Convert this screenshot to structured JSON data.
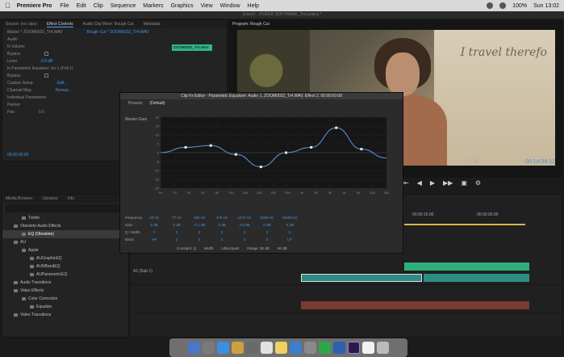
{
  "menubar": {
    "app_name": "Premiere Pro",
    "items": [
      "File",
      "Edit",
      "Clip",
      "Sequence",
      "Markers",
      "Graphics",
      "View",
      "Window",
      "Help"
    ],
    "battery": "100%",
    "clock": "Sun 13:02"
  },
  "window_title": "/Users/.../YUEER SOFTWARE_Test.prproj *",
  "effect_controls": {
    "tabs": [
      "Source: (no clips)",
      "Effect Controls",
      "Audio Clip Mixer: Rough Cut",
      "Metadata"
    ],
    "active_tab": "Effect Controls",
    "clip_path": "Master * ZOOM0032_Tr4.WAV",
    "sequence_path": "Rough Cut * ZOOM0032_Tr4.WAV",
    "clip_chip": "ZOOM0032_Tr4.WAV",
    "rows": [
      {
        "label": "Audio",
        "value": ""
      },
      {
        "label": "fx  Volume",
        "value": ""
      },
      {
        "label": "Bypass",
        "value": ""
      },
      {
        "label": "Level",
        "value": "0.0 dB"
      },
      {
        "label": "fx  Parametric Equalizer: Ex 1 (Fx8.1)",
        "value": ""
      },
      {
        "label": "Bypass",
        "value": ""
      },
      {
        "label": "Custom Setup",
        "value": "Edit..."
      },
      {
        "label": "Channel Map",
        "value": "Remap..."
      },
      {
        "label": "Individual Parameters",
        "value": ""
      },
      {
        "label": "Panner",
        "value": ""
      },
      {
        "label": "Pan",
        "value": "0.0"
      }
    ],
    "timecode": "00:00:00:00"
  },
  "program_monitor": {
    "title": "Program: Rough Cut",
    "script_text": "I travel therefo",
    "fit": "Full",
    "timecode": "00:14:34:12"
  },
  "eq_dialog": {
    "title": "Clip Fx Editor - Parametric Equalizer: Audio 1, ZOOM0032_Tr4.WAV, Effect 2, 00:00:00:00",
    "presets_label": "Presets:",
    "preset_value": "(Default)",
    "master_gain": "Master Gain",
    "y_ticks": [
      "20",
      "15",
      "10",
      "5",
      "0",
      "-5",
      "-10",
      "-15",
      "-20"
    ],
    "x_ticks": [
      "Hz",
      "20",
      "40",
      "60",
      "80",
      "100",
      "200",
      "300",
      "400",
      "500",
      "1k",
      "2k",
      "3k",
      "4k",
      "5k",
      "10k",
      "20k"
    ],
    "table": {
      "frequency_label": "Frequency",
      "gain_label": "Gain",
      "q_label": "Q / Width",
      "band_label": "Band",
      "frequencies": [
        "40 Hz",
        "77 Hz",
        "160 Hz",
        "475 Hz",
        "1474 Hz",
        "5369 Hz",
        "10000 Hz"
      ],
      "gains": [
        "5 dB",
        "0 dB",
        "-7.1 dB",
        "0 dB",
        "4.9 dB",
        "0 dB",
        "-4 dB"
      ],
      "q_values": [
        "2",
        "2",
        "2",
        "2",
        "2",
        "2",
        "2"
      ],
      "bands": [
        "HP",
        "1",
        "2",
        "3",
        "4",
        "5",
        "LP"
      ]
    },
    "bottom_options": [
      "Constant: Q",
      "Width",
      "Ultra-Quiet",
      "Range: 30 dB",
      "96 dB"
    ]
  },
  "chart_data": {
    "type": "line",
    "title": "",
    "x": [
      "20",
      "40",
      "100",
      "200",
      "400",
      "1k",
      "2k",
      "4k",
      "10k",
      "20k"
    ],
    "series": [
      {
        "values": [
          0,
          3,
          4,
          -1,
          -8,
          0,
          3,
          14,
          2,
          -3
        ]
      }
    ],
    "ylim": [
      -20,
      20
    ],
    "grid": true
  },
  "project_panel": {
    "tabs": [
      "Media Browser",
      "Libraries",
      "Info"
    ],
    "items": [
      {
        "label": "Treble",
        "selected": false
      },
      {
        "label": "Obsolete Audio Effects",
        "selected": false
      },
      {
        "label": "EQ (Obsolete)",
        "selected": true
      },
      {
        "label": "AU",
        "selected": false
      },
      {
        "label": "Apple",
        "selected": false
      },
      {
        "label": "AUGraphicEQ",
        "selected": false
      },
      {
        "label": "AUNBandEQ",
        "selected": false
      },
      {
        "label": "AUParametricEQ",
        "selected": false
      },
      {
        "label": "Audio Transitions",
        "selected": false
      },
      {
        "label": "Video Effects",
        "selected": false
      },
      {
        "label": "Color Correction",
        "selected": false
      },
      {
        "label": "Equalize",
        "selected": false
      },
      {
        "label": "Video Transitions",
        "selected": false
      }
    ]
  },
  "timeline": {
    "ruler": [
      "00:00:15:00",
      "00:00:30:00"
    ],
    "track_label": "A1 (Sub 1)"
  },
  "colors": {
    "accent": "#3f97e6",
    "clip_green": "#2fae79",
    "clip_teal": "#2d8d84",
    "clip_red": "#7a3b31"
  }
}
